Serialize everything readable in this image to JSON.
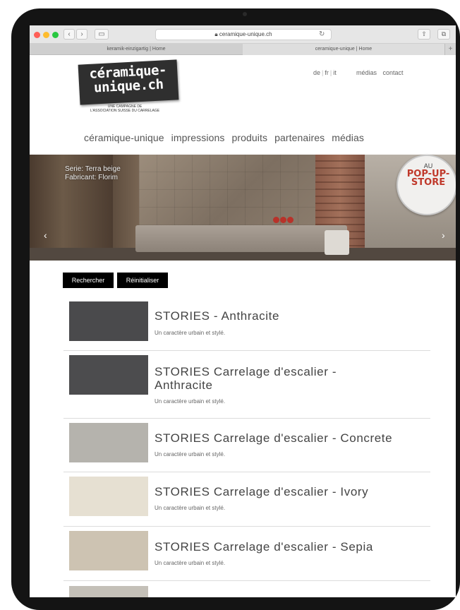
{
  "browser": {
    "url": "ceramique-unique.ch",
    "tabs": [
      "keramik-einzigartig | Home",
      "ceramique-unique | Home"
    ],
    "tab_new": "+"
  },
  "site": {
    "logo_lines": [
      "céramique-",
      "unique.ch"
    ],
    "logo_sub": [
      "UNE CAMPAGNE DE",
      "L'ASSOCIATION SUISSE DU CARRELAGE"
    ],
    "languages": [
      "de",
      "fr",
      "it"
    ],
    "top_links": [
      "médias",
      "contact"
    ],
    "nav": [
      "céramique-unique",
      "impressions",
      "produits",
      "partenaires",
      "médias"
    ]
  },
  "hero": {
    "caption_line1": "Serie: Terra beige",
    "caption_line2": "Fabricant: Florim",
    "badge_au": "AU",
    "badge_main": [
      "POP-UP-",
      "STORE"
    ],
    "prev": "‹",
    "next": "›"
  },
  "actions": {
    "search": "Rechercher",
    "reset": "Réinitialiser"
  },
  "products": [
    {
      "title": "STORIES - Anthracite",
      "desc": "Un caractère urbain et stylé.",
      "color": "#4a4a4c"
    },
    {
      "title_lines": [
        "STORIES Carrelage d'escalier -",
        "Anthracite"
      ],
      "desc": "Un caractère urbain et stylé.",
      "color": "#4c4c4e"
    },
    {
      "title": "STORIES Carrelage d'escalier - Concrete",
      "desc": "Un caractère urbain et stylé.",
      "color": "#b5b3ad"
    },
    {
      "title": "STORIES Carrelage d'escalier - Ivory",
      "desc": "Un caractère urbain et stylé.",
      "color": "#e6e0d2"
    },
    {
      "title": "STORIES Carrelage d'escalier - Sepia",
      "desc": "Un caractère urbain et stylé.",
      "color": "#cdc3b2"
    }
  ]
}
